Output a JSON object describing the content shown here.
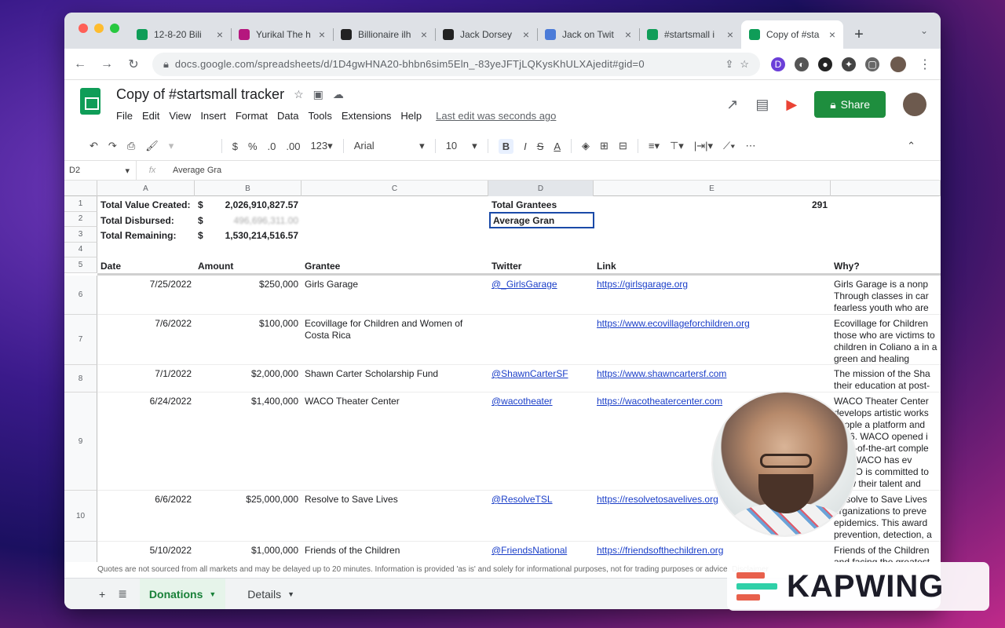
{
  "browser": {
    "tabs": [
      {
        "title": "12-8-20 Bili",
        "color": "#0f9d58"
      },
      {
        "title": "Yurikal The h",
        "color": "#b5177e"
      },
      {
        "title": "Billionaire ilh",
        "color": "#222222"
      },
      {
        "title": "Jack Dorsey",
        "color": "#222222"
      },
      {
        "title": "Jack on Twit",
        "color": "#4b7bd8"
      },
      {
        "title": "#startsmall i",
        "color": "#0f9d58"
      },
      {
        "title": "Copy of #sta",
        "color": "#0f9d58"
      }
    ],
    "close_glyph": "×",
    "newtab_glyph": "+",
    "url": "docs.google.com/spreadsheets/d/1D4gwHNA20-bhbn6sim5Eln_-83yeJFTjLQKysKhULXAjedit#gid=0",
    "extensions": [
      "D",
      "◐",
      "●",
      "✦",
      "▢"
    ]
  },
  "sheet": {
    "title": "Copy of #startsmall tracker",
    "menus": [
      "File",
      "Edit",
      "View",
      "Insert",
      "Format",
      "Data",
      "Tools",
      "Extensions",
      "Help"
    ],
    "last_edit": "Last edit was seconds ago",
    "share_label": "Share",
    "toolbar": {
      "currency": "$",
      "percent": "%",
      "dec_less": ".0",
      "dec_more": ".00",
      "more_formats": "123",
      "font": "Arial",
      "size": "10",
      "bold": "B",
      "italic": "I",
      "strike": "S",
      "color": "A"
    },
    "cell_ref": "D2",
    "formula_value": "Average Gra"
  },
  "grid": {
    "columns": [
      "A",
      "B",
      "C",
      "D",
      "E"
    ],
    "summary": [
      {
        "row": "1",
        "label": "Total Value Created:",
        "cur": "$",
        "value": "2,026,910,827.57",
        "label2": "Total Grantees",
        "value2": "291"
      },
      {
        "row": "2",
        "label": "Total Disbursed:",
        "cur": "$",
        "value": "496,696,311.00",
        "label2": "Average Gran",
        "value2": ""
      },
      {
        "row": "3",
        "label": "Total Remaining:",
        "cur": "$",
        "value": "1,530,214,516.57",
        "label2": "",
        "value2": ""
      },
      {
        "row": "4",
        "label": "",
        "cur": "",
        "value": "",
        "label2": "",
        "value2": ""
      }
    ],
    "headers": {
      "row": "5",
      "date": "Date",
      "amount": "Amount",
      "grantee": "Grantee",
      "twitter": "Twitter",
      "link": "Link",
      "why": "Why?"
    },
    "rows": [
      {
        "row": "6",
        "date": "7/25/2022",
        "amount": "$250,000",
        "grantee": "Girls Garage",
        "twitter": "@_GirlsGarage",
        "link": "https://girlsgarage.org",
        "why": "Girls Garage is a nonp Through classes in car fearless youth who are"
      },
      {
        "row": "7",
        "date": "7/6/2022",
        "amount": "$100,000",
        "grantee": "Ecovillage for Children and Women of Costa Rica",
        "twitter": "",
        "link": "https://www.ecovillageforchildren.org",
        "why": "Ecovillage for Children those who are victims to children in Coliano a in a green and healing"
      },
      {
        "row": "8",
        "date": "7/1/2022",
        "amount": "$2,000,000",
        "grantee": "Shawn Carter Scholarship Fund",
        "twitter": "@ShawnCarterSF",
        "link": "https://www.shawncartersf.com",
        "why": "The mission of the Sha their education at post-"
      },
      {
        "row": "9",
        "date": "6/24/2022",
        "amount": "$1,400,000",
        "grantee": "WACO Theater Center",
        "twitter": "@wacotheater",
        "link": "https://wacotheatercenter.com",
        "why": "WACO Theater Center develops artistic works people a platform and 2016. WACO opened i state-of-the-art comple city, WACO has ev WACO is committed to show their talent and"
      },
      {
        "row": "10",
        "date": "6/6/2022",
        "amount": "$25,000,000",
        "grantee": "Resolve to Save Lives",
        "twitter": "@ResolveTSL",
        "link": "https://resolvetosavelives.org",
        "why": "Resolve to Save Lives organizations to preve epidemics. This award prevention, detection, a"
      },
      {
        "row": "",
        "date": "5/10/2022",
        "amount": "$1,000,000",
        "grantee": "Friends of the Children",
        "twitter": "@FriendsNational",
        "link": "https://friendsofthechildren.org",
        "why": "Friends of the Children and facing the greatest"
      }
    ]
  },
  "footer": {
    "disclaimer": "Quotes are not sourced from all markets and may be delayed up to 20 minutes. Information is provided 'as is' and solely for informational purposes, not for trading purposes or advice. Disclaimer",
    "add_glyph": "+",
    "list_glyph": "≣",
    "tabs": [
      "Donations",
      "Details"
    ]
  },
  "overlay": {
    "watermark": "KAPWING",
    "logo_colors": [
      "#e8604c",
      "#2fd0a8",
      "#e8604c"
    ]
  },
  "colors": {
    "share_green": "#1e8e3e",
    "link_blue": "#1a3ec8",
    "selection": "#1a4aa8"
  }
}
